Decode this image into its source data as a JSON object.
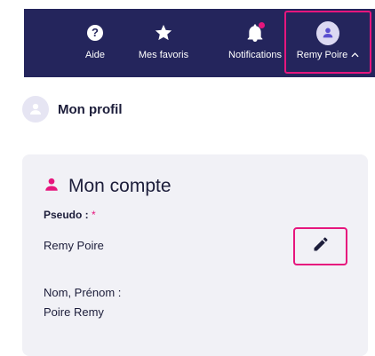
{
  "nav": {
    "aide_label": "Aide",
    "favoris_label": "Mes favoris",
    "notifications_label": "Notifications",
    "user_label": "Remy Poire",
    "icons": {
      "aide": "help-icon",
      "favoris": "star-icon",
      "notifications": "bell-icon",
      "user": "user-avatar-icon",
      "user_caret": "chevron-up-icon"
    }
  },
  "profile": {
    "title": "Mon profil",
    "icon": "user-avatar-icon"
  },
  "account": {
    "title": "Mon compte",
    "icon": "person-icon",
    "pseudo_label": "Pseudo : ",
    "required_mark": "*",
    "pseudo_value": "Remy Poire",
    "edit_icon": "pencil-icon",
    "nom_label": "Nom, Prénom :",
    "nom_value": "Poire Remy"
  },
  "colors": {
    "nav_bg": "#24255c",
    "accent": "#e6167d",
    "avatar_bg": "#e6e5f3",
    "card_bg": "#f1f1f6"
  }
}
